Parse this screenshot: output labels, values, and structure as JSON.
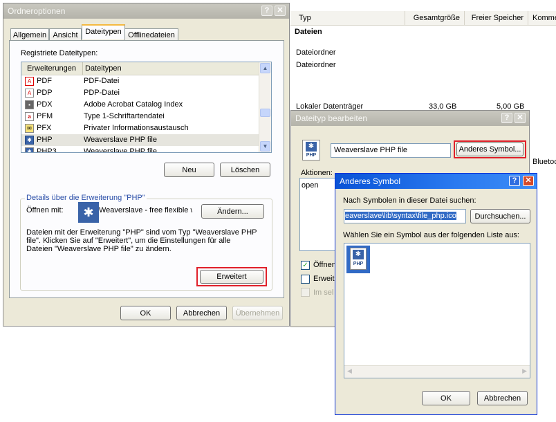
{
  "background": {
    "columns": [
      "Typ",
      "Gesamtgröße",
      "Freier Speicher",
      "Komme"
    ],
    "section_title": "Dateien",
    "rows": [
      "Dateiordner",
      "Dateiordner"
    ],
    "drive_row": {
      "type": "Lokaler Datenträger",
      "size": "33,0 GB",
      "free": "5,00 GB"
    },
    "side_text": "Bluetoo"
  },
  "ordneroptionen": {
    "title": "Ordneroptionen",
    "tabs": [
      "Allgemein",
      "Ansicht",
      "Dateitypen",
      "Offlinedateien"
    ],
    "registered_label": "Registriete Dateitypen:",
    "list_headers": [
      "Erweiterungen",
      "Dateitypen"
    ],
    "rows": [
      {
        "ext": "PDF",
        "type": "PDF-Datei"
      },
      {
        "ext": "PDP",
        "type": "PDP-Datei"
      },
      {
        "ext": "PDX",
        "type": "Adobe Acrobat Catalog Index"
      },
      {
        "ext": "PFM",
        "type": "Type 1-Schriftartendatei"
      },
      {
        "ext": "PFX",
        "type": "Privater Informationsaustausch"
      },
      {
        "ext": "PHP",
        "type": "Weaverslave PHP file"
      },
      {
        "ext": "PHP3",
        "type": "Weaverslave PHP file"
      }
    ],
    "new_btn": "Neu",
    "delete_btn": "Löschen",
    "details_label": "Details über die Erweiterung \"PHP\"",
    "open_with_label": "Öffnen mit:",
    "open_with_value": "Weaverslave - free flexible w",
    "change_btn": "Ändern...",
    "description": "Dateien mit der Erweiterung \"PHP\" sind vom Typ \"Weaverslave PHP file\". Klicken Sie auf \"Erweitert\", um die Einstellungen für alle Dateien \"Weaverslave PHP file\" zu ändern.",
    "advanced_btn": "Erweitert",
    "ok_btn": "OK",
    "cancel_btn": "Abbrechen",
    "apply_btn": "Übernehmen"
  },
  "dateityp": {
    "title": "Dateityp bearbeiten",
    "name_value": "Weaverslave PHP file",
    "change_icon_btn": "Anderes Symbol...",
    "actions_label": "Aktionen:",
    "action_open": "open",
    "check1": "Öffnen",
    "check2": "Erweit",
    "check3": "Im sel"
  },
  "symbol": {
    "title": "Anderes Symbol",
    "search_label": "Nach Symbolen in dieser Datei suchen:",
    "path_value": "eaverslave\\lib\\syntax\\file_php.ico",
    "browse_btn": "Durchsuchen...",
    "choose_label": "Wählen Sie ein Symbol aus der folgenden Liste aus:",
    "ok_btn": "OK",
    "cancel_btn": "Abbrechen"
  },
  "icons": {
    "php": "PHP"
  },
  "colors": {
    "highlight": "#e0202a",
    "titlebar_active": "#0a53d6",
    "selection": "#316ac5"
  }
}
